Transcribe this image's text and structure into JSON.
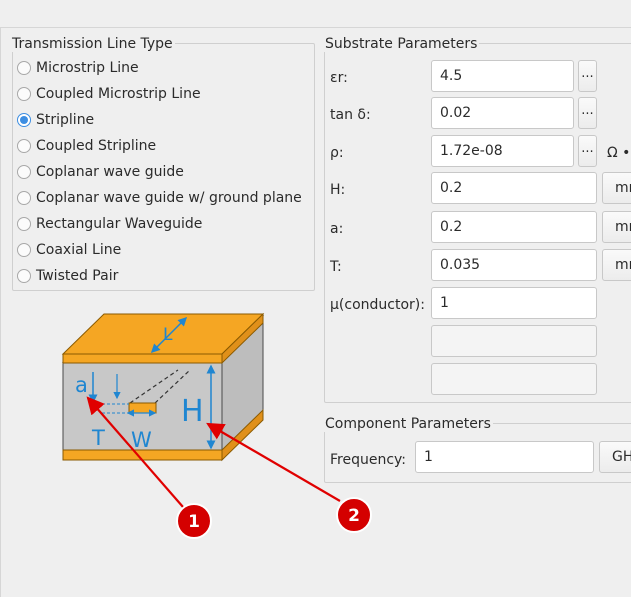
{
  "transmission": {
    "title": "Transmission Line Type",
    "options": [
      {
        "label": "Microstrip Line",
        "checked": false
      },
      {
        "label": "Coupled Microstrip Line",
        "checked": false
      },
      {
        "label": "Stripline",
        "checked": true
      },
      {
        "label": "Coupled Stripline",
        "checked": false
      },
      {
        "label": "Coplanar wave guide",
        "checked": false
      },
      {
        "label": "Coplanar wave guide w/ ground plane",
        "checked": false
      },
      {
        "label": "Rectangular Waveguide",
        "checked": false
      },
      {
        "label": "Coaxial Line",
        "checked": false
      },
      {
        "label": "Twisted Pair",
        "checked": false
      }
    ]
  },
  "substrate": {
    "title": "Substrate Parameters",
    "er": {
      "label": "εr:",
      "value": "4.5",
      "more": "..."
    },
    "tan": {
      "label": "tan δ:",
      "value": "0.02",
      "more": "..."
    },
    "rho": {
      "label": "ρ:",
      "value": "1.72e-08",
      "more": "...",
      "unit": "Ω •"
    },
    "h": {
      "label": "H:",
      "value": "0.2",
      "unit": "mm"
    },
    "a": {
      "label": "a:",
      "value": "0.2",
      "unit": "mm"
    },
    "t": {
      "label": "T:",
      "value": "0.035",
      "unit": "mm"
    },
    "mu": {
      "label": "μ(conductor):",
      "value": "1"
    }
  },
  "component": {
    "title": "Component Parameters",
    "frequency": {
      "label": "Frequency:",
      "value": "1",
      "unit": "GHz"
    }
  },
  "diagram": {
    "label_L": "L",
    "label_a": "a",
    "label_T": "T",
    "label_W": "W",
    "label_H": "H"
  },
  "callouts": [
    {
      "number": "1"
    },
    {
      "number": "2"
    }
  ],
  "colors": {
    "accent": "#3d8ee2",
    "copper": "#f5a623",
    "dielectric": "#c8c8c8",
    "dimension": "#1f86d1",
    "callout": "#e00000"
  }
}
